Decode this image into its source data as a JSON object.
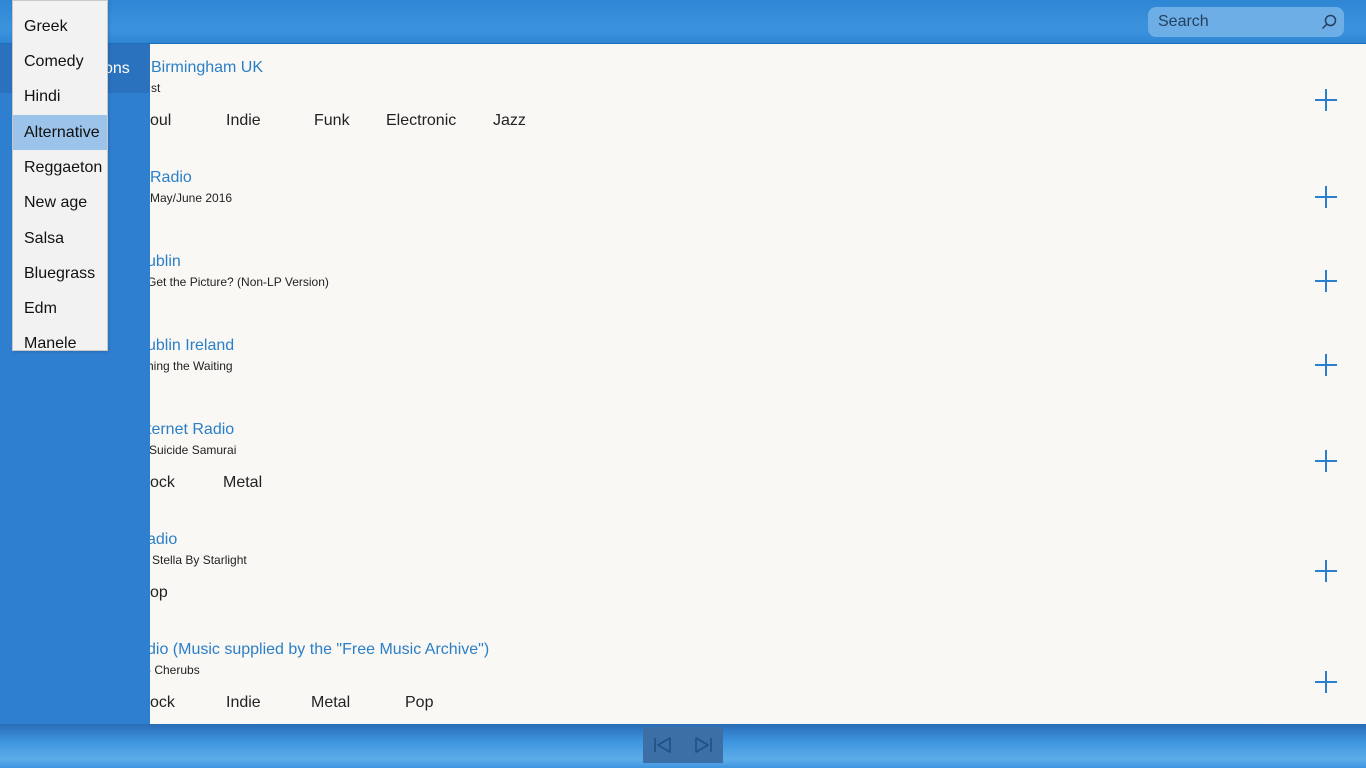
{
  "search": {
    "placeholder": "Search"
  },
  "sidebar": {
    "label": "ons"
  },
  "stations": [
    {
      "name": "Birmingham UK",
      "track": "st",
      "genres": [
        "oul",
        "Indie",
        "Funk",
        "Electronic",
        "Jazz"
      ]
    },
    {
      "name": "Radio",
      "track": "May/June 2016",
      "genres": []
    },
    {
      "name": "ublin",
      "track": "Get the Picture? (Non-LP Version)",
      "genres": []
    },
    {
      "name": "ublin Ireland",
      "track": "hing the Waiting",
      "genres": []
    },
    {
      "name": "ternet Radio",
      "track": "Suicide Samurai",
      "genres": [
        "ock",
        "Metal"
      ]
    },
    {
      "name": "adio",
      "track": "Stella By Starlight",
      "genres": [
        "op"
      ]
    },
    {
      "name": "dio (Music supplied by the \"Free Music Archive\")",
      "track": "- Cherubs",
      "genres": [
        "ock",
        "Indie",
        "Metal",
        "Pop"
      ]
    }
  ],
  "dropdown": {
    "items": [
      "Greek",
      "Comedy",
      "Hindi",
      "Alternative",
      "Reggaeton",
      "New age",
      "Salsa",
      "Bluegrass",
      "Edm",
      "Manele"
    ],
    "selected": "Alternative"
  },
  "icons": {
    "search": "search-icon",
    "add": "plus-icon",
    "prev": "skip-previous-icon",
    "next": "skip-next-icon"
  },
  "colors": {
    "accent": "#2b7fd0",
    "topbar": "#3c93dd",
    "sidebar": "#2f7fd1",
    "selected": "#9cc3e9"
  }
}
